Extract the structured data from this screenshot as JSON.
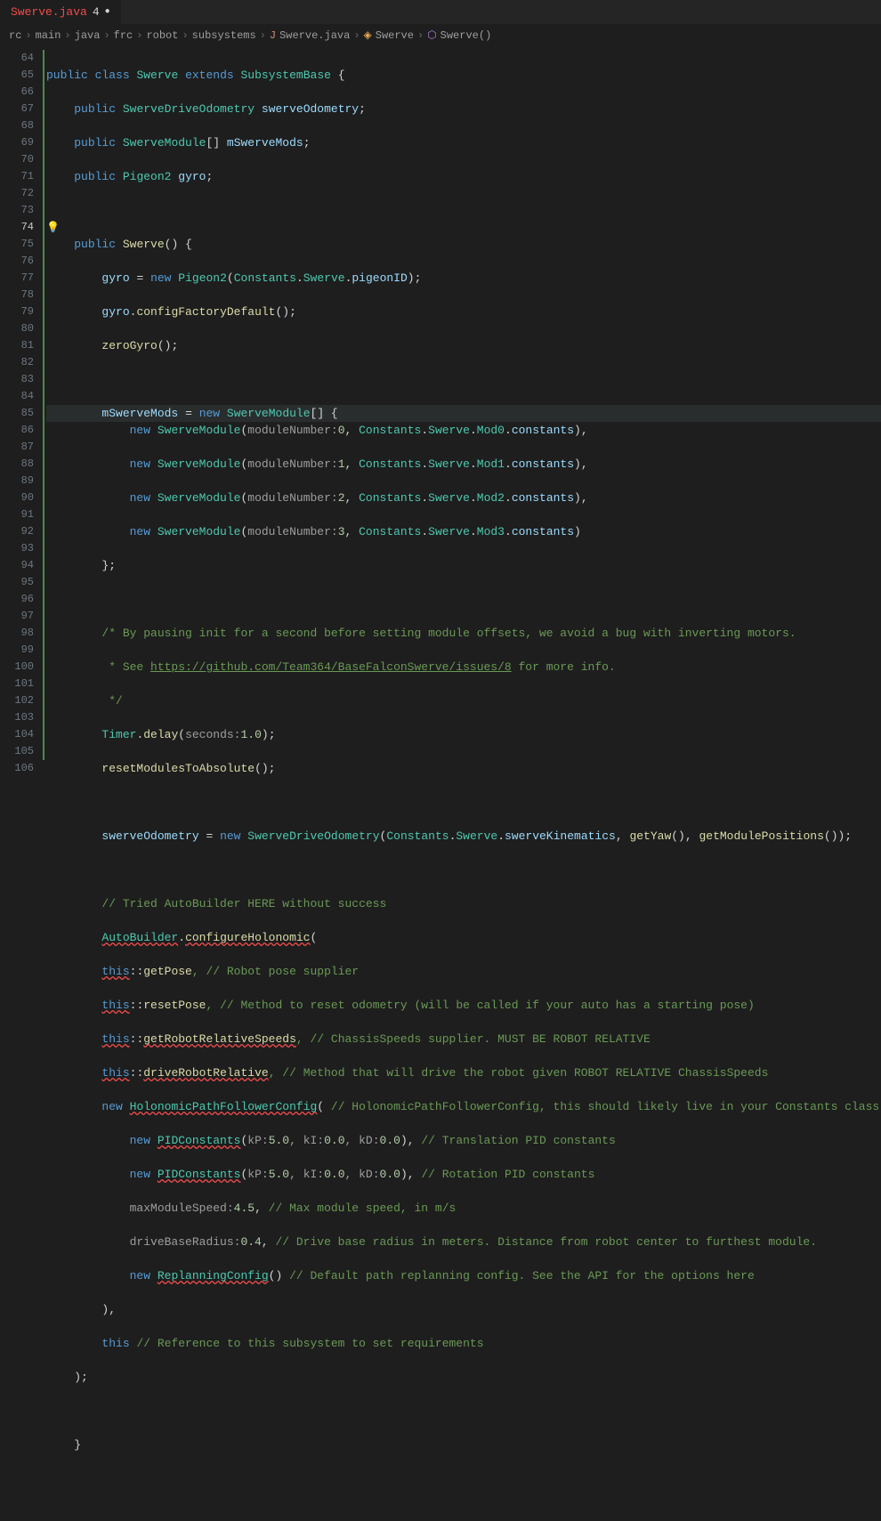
{
  "tab": {
    "title": "Swerve.java",
    "count": "4",
    "modified_dot": "●"
  },
  "breadcrumb": {
    "parts": [
      "rc",
      "main",
      "java",
      "frc",
      "robot",
      "subsystems",
      "Swerve.java",
      "Swerve",
      "Swerve()"
    ],
    "sep": "›"
  },
  "line_start": 64,
  "line_end": 106,
  "current_line": 74,
  "bulb_glyph": "💡",
  "mod_ranges": [
    [
      64,
      105
    ],
    [
      88,
      105
    ]
  ],
  "code": {
    "l64": {
      "kw1": "public",
      "kw2": "class",
      "cls": "Swerve",
      "kw3": "extends",
      "sup": "SubsystemBase",
      "b": "{"
    },
    "l65": {
      "kw": "public",
      "t": "SwerveDriveOdometry",
      "v": "swerveOdometry",
      ";": ";"
    },
    "l66": {
      "kw": "public",
      "t": "SwerveModule",
      "br": "[]",
      "v": "mSwerveMods",
      ";": ";"
    },
    "l67": {
      "kw": "public",
      "t": "Pigeon2",
      "v": "gyro",
      ";": ";"
    },
    "l69": {
      "kw": "public",
      "fn": "Swerve",
      "p": "() {"
    },
    "l70": {
      "lhs": "gyro",
      "op": "=",
      "kw": "new",
      "t": "Pigeon2",
      "lp": "(",
      "c1": "Constants",
      "c2": "Swerve",
      "p": "pigeonID",
      "rp": ");"
    },
    "l71": {
      "lhs": "gyro",
      "fn": "configFactoryDefault",
      "p": "();"
    },
    "l72": {
      "fn": "zeroGyro",
      "p": "();"
    },
    "l74": {
      "lhs": "mSwerveMods",
      "op": "=",
      "kw": "new",
      "t": "SwerveModule",
      "br": "[] {"
    },
    "l75": {
      "kw": "new",
      "t": "SwerveModule",
      "lp": "(",
      "pn": "moduleNumber:",
      "n": "0",
      "c1": "Constants",
      "c2": "Swerve",
      "m": "Mod0",
      "p": "constants",
      "rp": "),"
    },
    "l76": {
      "kw": "new",
      "t": "SwerveModule",
      "lp": "(",
      "pn": "moduleNumber:",
      "n": "1",
      "c1": "Constants",
      "c2": "Swerve",
      "m": "Mod1",
      "p": "constants",
      "rp": "),"
    },
    "l77": {
      "kw": "new",
      "t": "SwerveModule",
      "lp": "(",
      "pn": "moduleNumber:",
      "n": "2",
      "c1": "Constants",
      "c2": "Swerve",
      "m": "Mod2",
      "p": "constants",
      "rp": "),"
    },
    "l78": {
      "kw": "new",
      "t": "SwerveModule",
      "lp": "(",
      "pn": "moduleNumber:",
      "n": "3",
      "c1": "Constants",
      "c2": "Swerve",
      "m": "Mod3",
      "p": "constants",
      "rp": ")"
    },
    "l79": {
      "t": "};"
    },
    "l81": {
      "c": "/* By pausing init for a second before setting module offsets, we avoid a bug with inverting motors."
    },
    "l82": {
      "c1": " * See ",
      "url": "https://github.com/Team364/BaseFalconSwerve/issues/8",
      "c2": " for more info."
    },
    "l83": {
      "c": " */"
    },
    "l84": {
      "t": "Timer",
      "fn": "delay",
      "lp": "(",
      "pn": "seconds:",
      "n": "1.0",
      "rp": ");"
    },
    "l85": {
      "fn": "resetModulesToAbsolute",
      "p": "();"
    },
    "l87": {
      "lhs": "swerveOdometry",
      "op": "=",
      "kw": "new",
      "t": "SwerveDriveOdometry",
      "lp": "(",
      "c1": "Constants",
      "c2": "Swerve",
      "p": "swerveKinematics",
      "s": ", ",
      "f1": "getYaw",
      "p1": "(), ",
      "f2": "getModulePositions",
      "rp": "());"
    },
    "l89": {
      "c": "// Tried AutoBuilder HERE without success"
    },
    "l90": {
      "t": "AutoBuilder",
      "fn": "configureHolonomic",
      "p": "("
    },
    "l91": {
      "th": "this",
      "sep": "::",
      "fn": "getPose",
      "c": ", // Robot pose supplier"
    },
    "l92": {
      "th": "this",
      "sep": "::",
      "fn": "resetPose",
      "c": ", // Method to reset odometry (will be called if your auto has a starting pose)"
    },
    "l93": {
      "th": "this",
      "sep": "::",
      "fn": "getRobotRelativeSpeeds",
      "c": ", // ChassisSpeeds supplier. MUST BE ROBOT RELATIVE"
    },
    "l94": {
      "th": "this",
      "sep": "::",
      "fn": "driveRobotRelative",
      "c": ", // Method that will drive the robot given ROBOT RELATIVE ChassisSpeeds"
    },
    "l95": {
      "kw": "new",
      "t": "HolonomicPathFollowerConfig",
      "p": "( ",
      "c": "// HolonomicPathFollowerConfig, this should likely live in your Constants class"
    },
    "l96": {
      "kw": "new",
      "t": "PIDConstants",
      "lp": "(",
      "p1": "kP:",
      "n1": "5.0",
      "p2": ", kI:",
      "n2": "0.0",
      "p3": ", kD:",
      "n3": "0.0",
      "rp": "), ",
      "c": "// Translation PID constants"
    },
    "l97": {
      "kw": "new",
      "t": "PIDConstants",
      "lp": "(",
      "p1": "kP:",
      "n1": "5.0",
      "p2": ", kI:",
      "n2": "0.0",
      "p3": ", kD:",
      "n3": "0.0",
      "rp": "), ",
      "c": "// Rotation PID constants"
    },
    "l98": {
      "pn": "maxModuleSpeed:",
      "n": "4.5",
      "s": ", ",
      "c": "// Max module speed, in m/s"
    },
    "l99": {
      "pn": "driveBaseRadius:",
      "n": "0.4",
      "s": ", ",
      "c": "// Drive base radius in meters. Distance from robot center to furthest module."
    },
    "l100": {
      "kw": "new",
      "t": "ReplanningConfig",
      "p": "() ",
      "c": "// Default path replanning config. See the API for the options here"
    },
    "l101": {
      "t": "),"
    },
    "l102": {
      "th": "this",
      "c": " // Reference to this subsystem to set requirements"
    },
    "l103": {
      "t": ");"
    },
    "l105": {
      "t": "}"
    }
  }
}
